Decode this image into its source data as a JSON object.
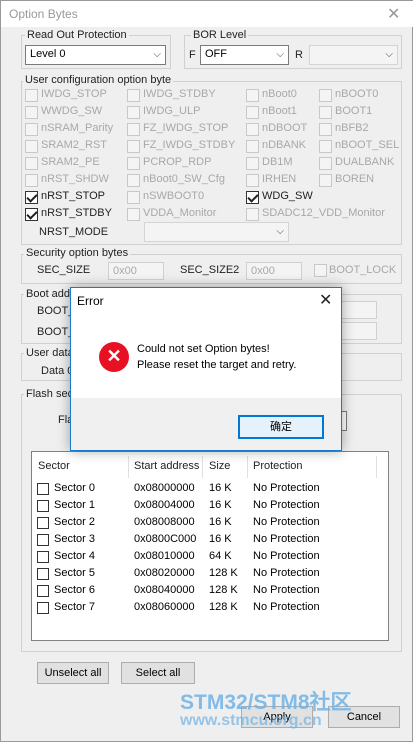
{
  "window": {
    "title": "Option Bytes",
    "close_glyph": "✕"
  },
  "rop": {
    "label": "Read Out Protection",
    "value": "Level 0"
  },
  "bor": {
    "label": "BOR Level",
    "f_label": "F",
    "f_value": "OFF",
    "r_label": "R",
    "r_value": ""
  },
  "user_config": {
    "label": "User configuration option byte",
    "items": [
      {
        "label": "IWDG_STOP",
        "checked": false
      },
      {
        "label": "IWDG_STDBY",
        "checked": false
      },
      {
        "label": "nBoot0",
        "checked": false
      },
      {
        "label": "nBOOT0",
        "checked": false
      },
      {
        "label": "WWDG_SW",
        "checked": false
      },
      {
        "label": "IWDG_ULP",
        "checked": false
      },
      {
        "label": "nBoot1",
        "checked": false
      },
      {
        "label": "BOOT1",
        "checked": false
      },
      {
        "label": "nSRAM_Parity",
        "checked": false
      },
      {
        "label": "FZ_IWDG_STOP",
        "checked": false
      },
      {
        "label": "nDBOOT",
        "checked": false
      },
      {
        "label": "nBFB2",
        "checked": false
      },
      {
        "label": "SRAM2_RST",
        "checked": false
      },
      {
        "label": "FZ_IWDG_STDBY",
        "checked": false
      },
      {
        "label": "nDBANK",
        "checked": false
      },
      {
        "label": "nBOOT_SEL",
        "checked": false
      },
      {
        "label": "SRAM2_PE",
        "checked": false
      },
      {
        "label": "PCROP_RDP",
        "checked": false
      },
      {
        "label": "DB1M",
        "checked": false
      },
      {
        "label": "DUALBANK",
        "checked": false
      },
      {
        "label": "nRST_SHDW",
        "checked": false
      },
      {
        "label": "nBoot0_SW_Cfg",
        "checked": false
      },
      {
        "label": "IRHEN",
        "checked": false
      },
      {
        "label": "BOREN",
        "checked": false
      },
      {
        "label": "nRST_STOP",
        "checked": true
      },
      {
        "label": "nSWBOOT0",
        "checked": false
      },
      {
        "label": "WDG_SW",
        "checked": true
      },
      {
        "label": "",
        "checked": false
      },
      {
        "label": "nRST_STDBY",
        "checked": true
      },
      {
        "label": "VDDA_Monitor",
        "checked": false
      },
      {
        "label": "SDADC12_VDD_Monitor",
        "checked": false
      },
      {
        "label": "",
        "checked": false
      }
    ],
    "nrst_mode_label": "NRST_MODE"
  },
  "security": {
    "label": "Security option bytes",
    "sec_size_label": "SEC_SIZE",
    "sec_size_value": "0x00",
    "sec_size2_label": "SEC_SIZE2",
    "sec_size2_value": "0x00",
    "boot_lock_label": "BOOT_LOCK"
  },
  "boot": {
    "label": "Boot addr",
    "row1": "BOOT_",
    "row2": "BOOT_"
  },
  "user_data": {
    "label": "User data",
    "row1": "Data 0"
  },
  "flash": {
    "label": "Flash sect",
    "row_label": "Fla",
    "columns": [
      "Sector",
      "Start address",
      "Size",
      "Protection"
    ],
    "rows": [
      {
        "sector": "Sector 0",
        "start": "0x08000000",
        "size": "16 K",
        "prot": "No Protection"
      },
      {
        "sector": "Sector 1",
        "start": "0x08004000",
        "size": "16 K",
        "prot": "No Protection"
      },
      {
        "sector": "Sector 2",
        "start": "0x08008000",
        "size": "16 K",
        "prot": "No Protection"
      },
      {
        "sector": "Sector 3",
        "start": "0x0800C000",
        "size": "16 K",
        "prot": "No Protection"
      },
      {
        "sector": "Sector 4",
        "start": "0x08010000",
        "size": "64 K",
        "prot": "No Protection"
      },
      {
        "sector": "Sector 5",
        "start": "0x08020000",
        "size": "128 K",
        "prot": "No Protection"
      },
      {
        "sector": "Sector 6",
        "start": "0x08040000",
        "size": "128 K",
        "prot": "No Protection"
      },
      {
        "sector": "Sector 7",
        "start": "0x08060000",
        "size": "128 K",
        "prot": "No Protection"
      }
    ]
  },
  "buttons": {
    "unselect_all": "Unselect all",
    "select_all": "Select all",
    "apply": "Apply",
    "cancel": "Cancel"
  },
  "dialog": {
    "title": "Error",
    "close_glyph": "✕",
    "icon_glyph": "✕",
    "line1": "Could not set Option bytes!",
    "line2": "Please reset the target and retry.",
    "ok_label": "确定"
  },
  "watermark": {
    "line1": "STM32/STM8社区",
    "line2": "www.stmcu.org.cn"
  }
}
